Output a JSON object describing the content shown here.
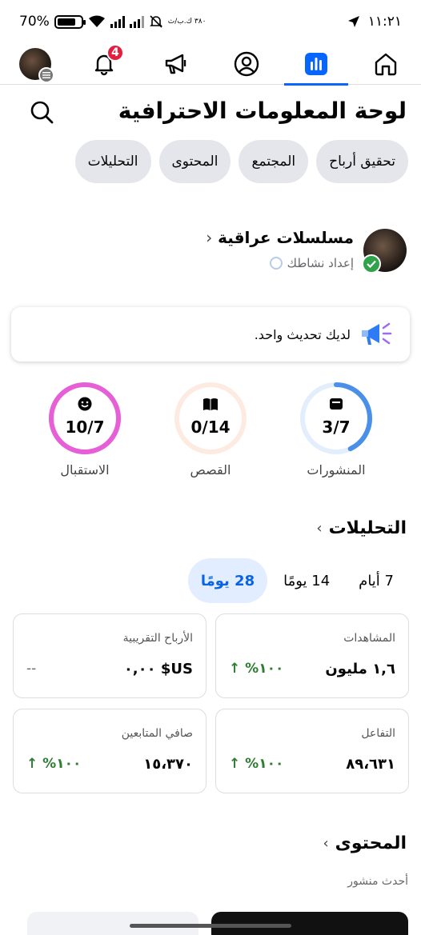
{
  "status_bar": {
    "battery": "70%",
    "speed": "٣٨٠ ك.ب/ث",
    "time": "١١:٢١"
  },
  "nav": {
    "notification_count": "4"
  },
  "header": {
    "title": "لوحة المعلومات الاحترافية"
  },
  "chips": [
    "التحليلات",
    "المحتوى",
    "المجتمع",
    "تحقيق أرباح"
  ],
  "profile": {
    "name": "مسلسلات عراقية",
    "chevron": "‹",
    "setup_activity": "إعداد نشاطك"
  },
  "update_card": {
    "text": "لديك تحديث واحد."
  },
  "rings": [
    {
      "label": "المنشورات",
      "value": "3/7",
      "progress": 0.43,
      "color": "#4a90e8",
      "track": "#e3eefd",
      "icon": "posts-icon"
    },
    {
      "label": "القصص",
      "value": "0/14",
      "progress": 0.0,
      "color": "#f4a67a",
      "track": "#fdebe1",
      "icon": "book-icon"
    },
    {
      "label": "الاستقبال",
      "value": "10/7",
      "progress": 1.0,
      "color": "#e65fd6",
      "track": "#f9e1f6",
      "icon": "smile-icon"
    }
  ],
  "analytics": {
    "title": "التحليلات",
    "chevron": "›",
    "ranges": [
      "28 يومًا",
      "14 يومًا",
      "7 أيام"
    ],
    "active_range": 0,
    "metrics": [
      {
        "label": "المشاهدات",
        "value": "١,٦ مليون",
        "change": "↑ %١٠٠"
      },
      {
        "label": "الأرباح التقريبية",
        "value": "US$ ٠,٠٠",
        "change": "--"
      },
      {
        "label": "التفاعل",
        "value": "٨٩،٦٣١",
        "change": "↑ %١٠٠"
      },
      {
        "label": "صافي المتابعين",
        "value": "١٥،٣٧٠",
        "change": "↑ %١٠٠"
      }
    ]
  },
  "content": {
    "title": "المحتوى",
    "chevron": "›",
    "latest_post": "أحدث منشور"
  }
}
